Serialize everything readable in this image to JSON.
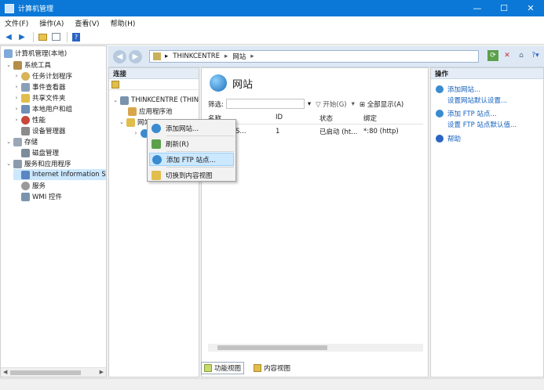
{
  "window": {
    "title": "计算机管理"
  },
  "menubar": {
    "file": "文件(F)",
    "action": "操作(A)",
    "view": "查看(V)",
    "help": "帮助(H)"
  },
  "tree": {
    "root": "计算机管理(本地)",
    "system_tools": "系统工具",
    "task_scheduler": "任务计划程序",
    "event_viewer": "事件查看器",
    "shared_folders": "共享文件夹",
    "local_users": "本地用户和组",
    "performance": "性能",
    "device_manager": "设备管理器",
    "storage": "存储",
    "disk_management": "磁盘管理",
    "services_apps": "服务和应用程序",
    "iis": "Internet Information S",
    "services": "服务",
    "wmi": "WMI 控件"
  },
  "address": {
    "server": "THINKCENTRE",
    "sites": "网站"
  },
  "connections": {
    "header": "连接",
    "server": "THINKCENTRE (THIN",
    "app_pools": "应用程序池",
    "sites": "网站"
  },
  "content": {
    "title": "网站",
    "filter_label": "筛选:",
    "start": "开始(G)",
    "show_all": "全部显示(A)",
    "columns": {
      "name": "名称",
      "id": "ID",
      "status": "状态",
      "binding": "绑定"
    },
    "rows": [
      {
        "name": "ult Web S...",
        "id": "1",
        "status": "已启动 (ht...",
        "binding": "*:80 (http)"
      }
    ],
    "tab_features": "功能视图",
    "tab_content": "内容视图"
  },
  "actions": {
    "header": "操作",
    "add_site": "添加网站...",
    "set_site_defaults": "设置网站默认设置...",
    "add_ftp": "添加 FTP 站点...",
    "set_ftp_defaults": "设置 FTP 站点默认值...",
    "help": "帮助"
  },
  "context_menu": {
    "add_site": "添加网站...",
    "refresh": "刷新(R)",
    "add_ftp": "添加 FTP 站点...",
    "switch_content": "切换到内容视图"
  },
  "colors": {
    "titlebar": "#0b78d7",
    "link": "#1560bd",
    "selection": "#cce8ff",
    "pane_header": "#e4ecf6"
  }
}
